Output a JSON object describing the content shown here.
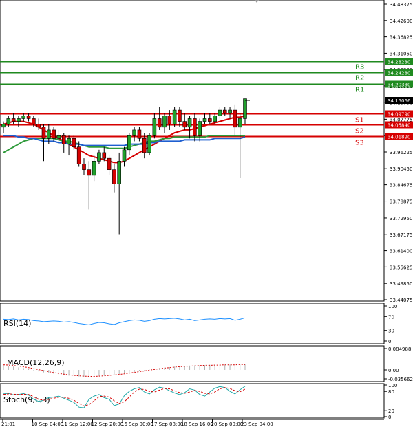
{
  "chart_data": {
    "type": "candlestick",
    "price_axis": {
      "ticks": [
        "34.48375",
        "34.42600",
        "34.36825",
        "34.31050",
        "34.25300",
        "34.19530",
        "34.13750",
        "34.07775",
        "34.02000",
        "33.96225",
        "33.90450",
        "33.84675",
        "33.78875",
        "33.72950",
        "33.67175",
        "33.61400",
        "33.55625",
        "33.49850",
        "33.44075"
      ],
      "ylim": [
        33.43,
        34.5
      ]
    },
    "current_price": "34.15066",
    "levels": [
      {
        "name": "R3",
        "value": 34.2823,
        "label": "34.28230",
        "color": "#1f8a1f"
      },
      {
        "name": "R2",
        "value": 34.2428,
        "label": "34.24280",
        "color": "#1f8a1f"
      },
      {
        "name": "R1",
        "value": 34.2033,
        "label": "34.20330",
        "color": "#1f8a1f"
      },
      {
        "name": "S1",
        "value": 34.0979,
        "label": "34.09790",
        "color": "#d60000"
      },
      {
        "name": "S2",
        "value": 34.0584,
        "label": "34.05840",
        "color": "#d60000"
      },
      {
        "name": "S3",
        "value": 34.0189,
        "label": "34.01890",
        "color": "#d60000"
      }
    ],
    "x_labels": [
      "21:01",
      "10 Sep 04:00",
      "11 Sep 12:00",
      "12 Sep 20:00",
      "16 Sep 00:00",
      "17 Sep 08:00",
      "18 Sep 16:00",
      "20 Sep 00:00",
      "23 Sep 04:00"
    ],
    "candles": [
      [
        34.05,
        34.07,
        34.03,
        34.06
      ],
      [
        34.06,
        34.09,
        34.05,
        34.08
      ],
      [
        34.08,
        34.1,
        34.06,
        34.07
      ],
      [
        34.07,
        34.09,
        34.05,
        34.08
      ],
      [
        34.08,
        34.1,
        34.07,
        34.09
      ],
      [
        34.09,
        34.1,
        34.07,
        34.08
      ],
      [
        34.08,
        34.09,
        34.05,
        34.06
      ],
      [
        34.06,
        34.08,
        34.04,
        34.05
      ],
      [
        34.05,
        34.06,
        33.93,
        34.01
      ],
      [
        34.01,
        34.06,
        33.99,
        34.04
      ],
      [
        34.04,
        34.05,
        34.0,
        34.01
      ],
      [
        34.01,
        34.04,
        33.99,
        34.02
      ],
      [
        34.02,
        34.03,
        33.96,
        33.99
      ],
      [
        33.99,
        34.02,
        33.95,
        34.01
      ],
      [
        34.01,
        34.02,
        33.97,
        33.98
      ],
      [
        33.98,
        34.0,
        33.91,
        33.92
      ],
      [
        33.92,
        33.94,
        33.88,
        33.9
      ],
      [
        33.9,
        33.93,
        33.76,
        33.88
      ],
      [
        33.88,
        33.95,
        33.86,
        33.93
      ],
      [
        33.93,
        33.97,
        33.92,
        33.96
      ],
      [
        33.96,
        33.98,
        33.93,
        33.94
      ],
      [
        33.94,
        33.95,
        33.88,
        33.9
      ],
      [
        33.9,
        33.92,
        33.82,
        33.85
      ],
      [
        33.85,
        33.96,
        33.67,
        33.93
      ],
      [
        33.93,
        33.98,
        33.91,
        33.97
      ],
      [
        33.97,
        34.03,
        33.95,
        34.02
      ],
      [
        34.02,
        34.05,
        34.0,
        34.04
      ],
      [
        34.04,
        34.05,
        34.0,
        34.01
      ],
      [
        34.01,
        34.03,
        33.94,
        33.96
      ],
      [
        33.96,
        34.03,
        33.95,
        34.02
      ],
      [
        34.02,
        34.1,
        34.01,
        34.08
      ],
      [
        34.08,
        34.12,
        34.04,
        34.05
      ],
      [
        34.05,
        34.1,
        34.03,
        34.09
      ],
      [
        34.09,
        34.11,
        34.04,
        34.06
      ],
      [
        34.06,
        34.12,
        34.05,
        34.11
      ],
      [
        34.11,
        34.12,
        34.05,
        34.07
      ],
      [
        34.07,
        34.1,
        34.04,
        34.05
      ],
      [
        34.05,
        34.09,
        34.01,
        34.08
      ],
      [
        34.08,
        34.1,
        34.0,
        34.02
      ],
      [
        34.02,
        34.08,
        34.0,
        34.07
      ],
      [
        34.07,
        34.1,
        34.06,
        34.08
      ],
      [
        34.08,
        34.1,
        34.06,
        34.07
      ],
      [
        34.07,
        34.1,
        34.06,
        34.09
      ],
      [
        34.09,
        34.12,
        34.08,
        34.11
      ],
      [
        34.11,
        34.12,
        34.09,
        34.1
      ],
      [
        34.1,
        34.12,
        34.08,
        34.11
      ],
      [
        34.11,
        34.13,
        34.02,
        34.05
      ],
      [
        34.05,
        34.1,
        33.87,
        34.08
      ],
      [
        34.08,
        34.15,
        34.06,
        34.15
      ]
    ],
    "ma_series": [
      {
        "color": "#d60000",
        "values": [
          34.06,
          34.065,
          34.07,
          34.07,
          34.07,
          34.065,
          34.06,
          34.05,
          34.04,
          34.03,
          34.02,
          34.01,
          34.0,
          33.99,
          33.98,
          33.97,
          33.96,
          33.95,
          33.945,
          33.94,
          33.935,
          33.93,
          33.925,
          33.925,
          33.93,
          33.94,
          33.95,
          33.96,
          33.97,
          33.98,
          33.99,
          34.0,
          34.01,
          34.02,
          34.03,
          34.035,
          34.04,
          34.04,
          34.045,
          34.05,
          34.055,
          34.06,
          34.065,
          34.07,
          34.075,
          34.08,
          34.085,
          34.085,
          34.09
        ]
      },
      {
        "color": "#2e9a3a",
        "values": [
          33.96,
          33.97,
          33.98,
          33.99,
          34.0,
          34.005,
          34.01,
          34.01,
          34.01,
          34.01,
          34.01,
          34.005,
          34.0,
          34.0,
          33.995,
          33.99,
          33.985,
          33.98,
          33.98,
          33.98,
          33.98,
          33.975,
          33.975,
          33.975,
          33.975,
          33.98,
          33.985,
          33.99,
          33.995,
          34.0,
          34.0,
          34.005,
          34.01,
          34.01,
          34.015,
          34.015,
          34.015,
          34.015,
          34.015,
          34.015,
          34.015,
          34.02,
          34.02,
          34.02,
          34.02,
          34.02,
          34.02,
          34.02,
          34.02
        ]
      },
      {
        "color": "#1f5fd0",
        "values": [
          34.02,
          34.02,
          34.02,
          34.015,
          34.015,
          34.01,
          34.01,
          34.005,
          34.0,
          34.0,
          34.0,
          33.995,
          33.995,
          33.99,
          33.99,
          33.99,
          33.985,
          33.985,
          33.985,
          33.985,
          33.985,
          33.985,
          33.985,
          33.985,
          33.985,
          33.99,
          33.99,
          33.99,
          33.99,
          33.995,
          33.995,
          34.0,
          34.0,
          34.0,
          34.0,
          34.0,
          34.005,
          34.005,
          34.005,
          34.005,
          34.005,
          34.005,
          34.01,
          34.01,
          34.01,
          34.01,
          34.01,
          34.01,
          34.015
        ]
      }
    ],
    "rsi": {
      "title": "RSI(14)",
      "ticks": [
        "100",
        "70",
        "30",
        "0"
      ],
      "values": [
        62,
        61,
        63,
        60,
        62,
        61,
        58,
        57,
        55,
        56,
        57,
        56,
        54,
        55,
        53,
        50,
        48,
        46,
        50,
        53,
        52,
        49,
        47,
        52,
        55,
        58,
        60,
        59,
        56,
        58,
        62,
        64,
        63,
        64,
        65,
        63,
        60,
        62,
        58,
        60,
        62,
        63,
        62,
        64,
        63,
        64,
        59,
        62,
        66
      ]
    },
    "macd": {
      "title": "MACD(12,26,9)",
      "ticks": [
        "0.084988",
        "0.00",
        "-0.035662"
      ],
      "hist": [
        0.018,
        0.016,
        0.013,
        0.01,
        0.007,
        0.003,
        -0.002,
        -0.006,
        -0.01,
        -0.013,
        -0.016,
        -0.019,
        -0.021,
        -0.023,
        -0.025,
        -0.026,
        -0.027,
        -0.027,
        -0.026,
        -0.025,
        -0.023,
        -0.021,
        -0.019,
        -0.017,
        -0.014,
        -0.011,
        -0.008,
        -0.005,
        -0.002,
        0.001,
        0.004,
        0.007,
        0.009,
        0.011,
        0.013,
        0.015,
        0.016,
        0.017,
        0.018,
        0.019,
        0.019,
        0.02,
        0.02,
        0.021,
        0.021,
        0.021,
        0.021,
        0.022,
        0.022
      ],
      "signal": [
        0.02,
        0.019,
        0.017,
        0.015,
        0.012,
        0.009,
        0.005,
        0.001,
        -0.003,
        -0.007,
        -0.011,
        -0.014,
        -0.017,
        -0.02,
        -0.022,
        -0.024,
        -0.025,
        -0.026,
        -0.026,
        -0.025,
        -0.024,
        -0.022,
        -0.02,
        -0.018,
        -0.016,
        -0.013,
        -0.01,
        -0.007,
        -0.004,
        -0.001,
        0.002,
        0.005,
        0.007,
        0.009,
        0.011,
        0.013,
        0.014,
        0.015,
        0.016,
        0.017,
        0.018,
        0.018,
        0.019,
        0.019,
        0.02,
        0.02,
        0.02,
        0.021,
        0.021
      ]
    },
    "stoch": {
      "title": "Stoch(9,6,3)",
      "ticks": [
        "100",
        "80",
        "20",
        "0"
      ],
      "k": [
        72,
        74,
        69,
        70,
        73,
        68,
        55,
        48,
        52,
        60,
        62,
        65,
        58,
        52,
        45,
        30,
        28,
        55,
        65,
        70,
        60,
        55,
        35,
        40,
        66,
        80,
        88,
        92,
        78,
        72,
        85,
        93,
        90,
        82,
        75,
        70,
        76,
        88,
        84,
        70,
        65,
        78,
        90,
        95,
        92,
        80,
        72,
        85,
        96
      ],
      "d": [
        70,
        72,
        71,
        70,
        71,
        70,
        63,
        55,
        52,
        55,
        58,
        62,
        61,
        58,
        52,
        42,
        34,
        38,
        50,
        63,
        65,
        62,
        50,
        42,
        47,
        62,
        78,
        87,
        86,
        80,
        78,
        84,
        89,
        88,
        82,
        76,
        74,
        78,
        83,
        80,
        74,
        72,
        78,
        88,
        92,
        89,
        82,
        79,
        87
      ]
    }
  }
}
